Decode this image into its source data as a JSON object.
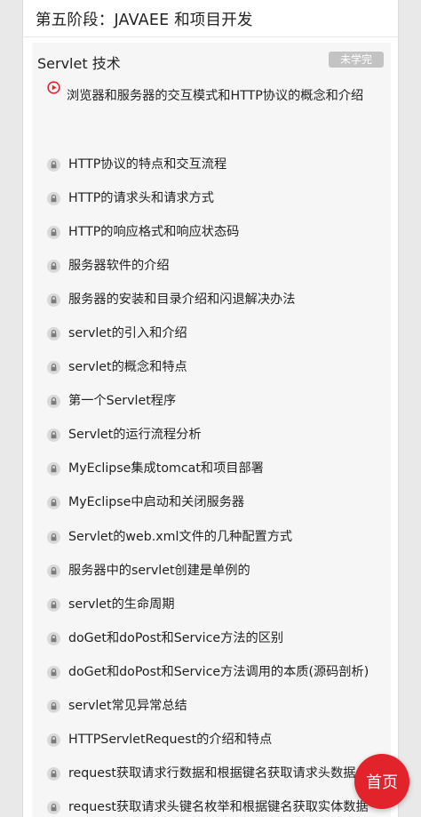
{
  "stage": {
    "title": "第五阶段：JAVAEE 和项目开发"
  },
  "section": {
    "title": "Servlet 技术",
    "status": "未学完"
  },
  "lessons": [
    {
      "label": "浏览器和服务器的交互模式和HTTP协议的概念和介绍",
      "icon": "play-icon"
    },
    {
      "label": "HTTP协议的特点和交互流程",
      "icon": "lock-icon"
    },
    {
      "label": "HTTP的请求头和请求方式",
      "icon": "lock-icon"
    },
    {
      "label": "HTTP的响应格式和响应状态码",
      "icon": "lock-icon"
    },
    {
      "label": "服务器软件的介绍",
      "icon": "lock-icon"
    },
    {
      "label": "服务器的安装和目录介绍和闪退解决办法",
      "icon": "lock-icon"
    },
    {
      "label": "servlet的引入和介绍",
      "icon": "lock-icon"
    },
    {
      "label": "servlet的概念和特点",
      "icon": "lock-icon"
    },
    {
      "label": "第一个Servlet程序",
      "icon": "lock-icon"
    },
    {
      "label": "Servlet的运行流程分析",
      "icon": "lock-icon"
    },
    {
      "label": "MyEclipse集成tomcat和项目部署",
      "icon": "lock-icon"
    },
    {
      "label": "MyEclipse中启动和关闭服务器",
      "icon": "lock-icon"
    },
    {
      "label": "Servlet的web.xml文件的几种配置方式",
      "icon": "lock-icon"
    },
    {
      "label": "服务器中的servlet创建是单例的",
      "icon": "lock-icon"
    },
    {
      "label": "servlet的生命周期",
      "icon": "lock-icon"
    },
    {
      "label": "doGet和doPost和Service方法的区别",
      "icon": "lock-icon"
    },
    {
      "label": "doGet和doPost和Service方法调用的本质(源码剖析)",
      "icon": "lock-icon"
    },
    {
      "label": "servlet常见异常总结",
      "icon": "lock-icon"
    },
    {
      "label": "HTTPServletRequest的介绍和特点",
      "icon": "lock-icon"
    },
    {
      "label": "request获取请求行数据和根据键名获取请求头数据",
      "icon": "lock-icon"
    },
    {
      "label": "request获取请求头键名枚举和根据键名获取实体数据",
      "icon": "lock-icon"
    }
  ],
  "home_button": {
    "label": "首页"
  },
  "colors": {
    "play_accent": "#e3232b",
    "lock_gray": "#8c8c8c",
    "badge_gray": "#c3c3c3",
    "home_red": "#e3232b"
  }
}
